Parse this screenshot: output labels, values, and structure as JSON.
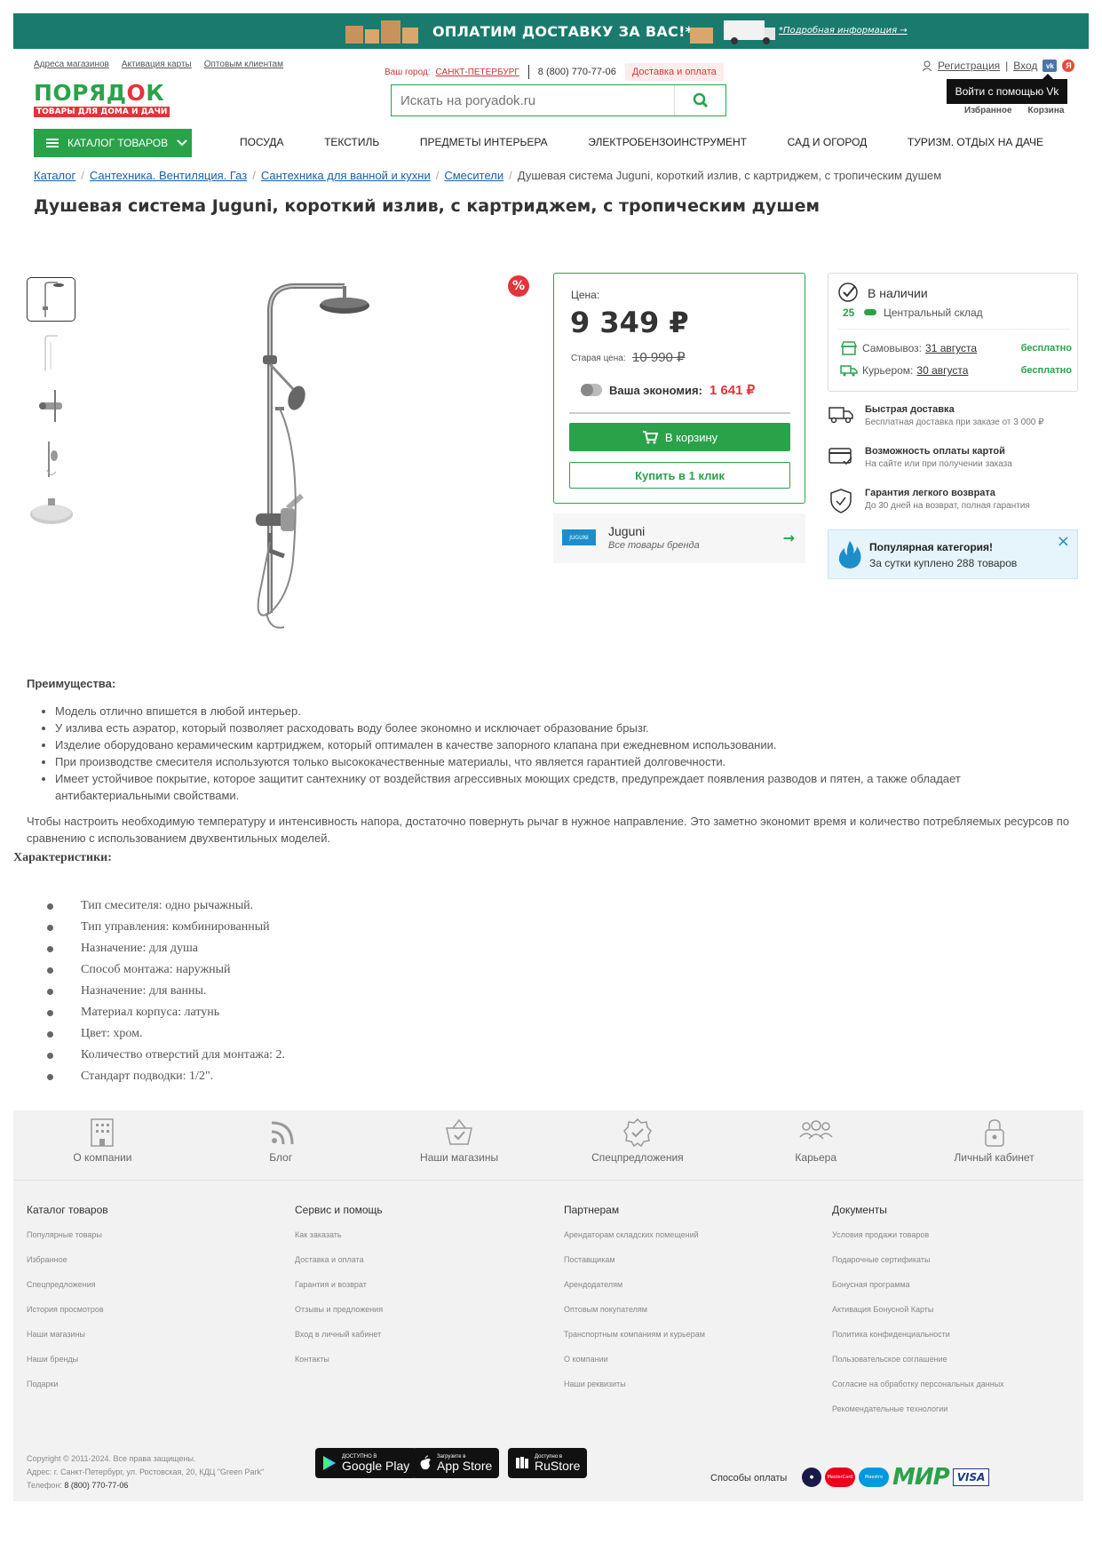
{
  "banner": {
    "title": "ОПЛАТИМ ДОСТАВКУ ЗА ВАС!*",
    "more": "*Подробная информация →"
  },
  "toplinks": [
    "Адреса магазинов",
    "Активация карты",
    "Оптовым клиентам"
  ],
  "city": {
    "label": "Ваш город:",
    "value": "САНКТ-ПЕТЕРБУРГ",
    "phone": "8 (800) 770-77-06",
    "delivery": "Доставка и оплата"
  },
  "auth": {
    "register": "Регистрация",
    "login": "Вход",
    "tooltip": "Войти с помощью Vk",
    "favorites": "Избранное",
    "cart": "Корзина"
  },
  "logo": {
    "word_a": "ПОРЯД",
    "word_o": "О",
    "word_b": "К",
    "tagline": "ТОВАРЫ ДЛЯ ДОМА И ДАЧИ"
  },
  "search": {
    "placeholder": "Искать на poryadok.ru"
  },
  "catalog_button": "КАТАЛОГ ТОВАРОВ",
  "nav": [
    "ПОСУДА",
    "ТЕКСТИЛЬ",
    "ПРЕДМЕТЫ ИНТЕРЬЕРА",
    "ЭЛЕКТРОБЕНЗОИНСТРУМЕНТ",
    "САД И ОГОРОД",
    "ТУРИЗМ. ОТДЫХ НА ДАЧЕ"
  ],
  "breadcrumbs": [
    "Каталог",
    "Сантехника. Вентиляция. Газ",
    "Сантехника для ванной и кухни",
    "Смесители"
  ],
  "breadcrumb_current": "Душевая система Juguni, короткий излив, с картриджем, с тропическим душем",
  "product": {
    "title": "Душевая система Juguni, короткий излив, с картриджем, с тропическим душем",
    "sale_badge": "%"
  },
  "price": {
    "label": "Цена:",
    "value": "9 349 ₽",
    "old_label": "Старая цена:",
    "old_value": "10 990 ₽",
    "economy_label": "Ваша экономия:",
    "economy_value": "1 641 ₽",
    "cart_button": "В корзину",
    "oneclick_button": "Купить в 1 клик"
  },
  "brand": {
    "logo_text": "JUGUNI",
    "name": "Juguni",
    "sub": "Все товары бренда"
  },
  "stock": {
    "title": "В наличии",
    "count": "25",
    "warehouse": "Центральный склад",
    "pickup_label": "Самовывоз:",
    "pickup_date": "31 августа",
    "pickup_price": "бесплатно",
    "courier_label": "Курьером:",
    "courier_date": "30 августа",
    "courier_price": "бесплатно"
  },
  "features": [
    {
      "title": "Быстрая доставка",
      "sub": "Бесплатная доставка при заказе от 3 000 ₽"
    },
    {
      "title": "Возможность оплаты картой",
      "sub": "На сайте или при получении заказа"
    },
    {
      "title": "Гарантия легкого возврата",
      "sub": "До 30 дней на возврат, полная гарантия"
    }
  ],
  "popular": {
    "title": "Популярная категория!",
    "sub": "За сутки куплено 288 товаров"
  },
  "advantages": {
    "heading": "Преимущества:",
    "items": [
      "Модель отлично впишется в любой интерьер.",
      "У излива есть аэратор, который позволяет расходовать воду более экономно и исключает образование брызг.",
      "Изделие оборудовано керамическим картриджем, который оптимален в качестве запорного клапана при ежедневном использовании.",
      "При производстве смесителя используются только высококачественные материалы, что является гарантией долговечности.",
      "Имеет устойчивое покрытие, которое защитит сантехнику от воздействия агрессивных моющих средств, предупреждает появления разводов и пятен, а также обладает антибактериальными свойствами."
    ],
    "paragraph": "Чтобы настроить необходимую температуру и интенсивность напора, достаточно повернуть рычаг в нужное направление. Это заметно экономит время и количество потребляемых ресурсов по сравнению с использованием двухвентильных моделей."
  },
  "specs": {
    "heading": "Характеристики:",
    "items": [
      "Тип смесителя: одно рычажный.",
      "Тип управления: комбинированный",
      "Назначение: для душа",
      "Способ монтажа: наружный",
      "Назначение: для ванны.",
      "Материал корпуса: латунь",
      "Цвет: хром.",
      "Количество отверстий для монтажа: 2.",
      "Стандарт подводки: 1/2\"."
    ]
  },
  "footer_icons": [
    "О компании",
    "Блог",
    "Наши магазины",
    "Спецпредложения",
    "Карьера",
    "Личный кабинет"
  ],
  "footer_cols": [
    {
      "heading": "Каталог товаров",
      "items": [
        "Популярные товары",
        "Избранное",
        "Спецпредложения",
        "История просмотров",
        "Наши магазины",
        "Наши бренды",
        "Подарки"
      ]
    },
    {
      "heading": "Сервис и помощь",
      "items": [
        "Как заказать",
        "Доставка и оплата",
        "Гарантия и возврат",
        "Отзывы и предложения",
        "Вход в личный кабинет",
        "Контакты"
      ]
    },
    {
      "heading": "Партнерам",
      "items": [
        "Арендаторам складских помещений",
        "Поставщикам",
        "Арендодателям",
        "Оптовым покупателям",
        "Транспортным компаниям и курьерам",
        "О компании",
        "Наши реквизиты"
      ]
    },
    {
      "heading": "Документы",
      "items": [
        "Условия продажи товаров",
        "Подарочные сертификаты",
        "Бонусная программа",
        "Активация Бонусной Карты",
        "Политика конфиденциальности",
        "Пользовательское соглашение",
        "Согласие на обработку персональных данных",
        "Рекомендательные технологии"
      ]
    }
  ],
  "copyright": {
    "line1": "Copyright © 2011-2024. Все права защищены.",
    "address": "Адрес: г. Санкт-Петербург, ул. Ростовская, 20, КДЦ \"Green Park\"",
    "phone_label": "Телефон:",
    "phone": "8 (800) 770-77-06"
  },
  "stores": [
    {
      "small": "ДОСТУПНО В",
      "big": "Google Play"
    },
    {
      "small": "Загрузите в",
      "big": "App Store"
    },
    {
      "small": "Доступно в",
      "big": "RuStore"
    }
  ],
  "payment_label": "Способы оплаты",
  "payment_brands": [
    "MasterCard",
    "Maestro",
    "МИР",
    "VISA"
  ],
  "colors": {
    "green": "#2aa24a",
    "red": "#e2343b",
    "banner": "#1a7a6e"
  }
}
